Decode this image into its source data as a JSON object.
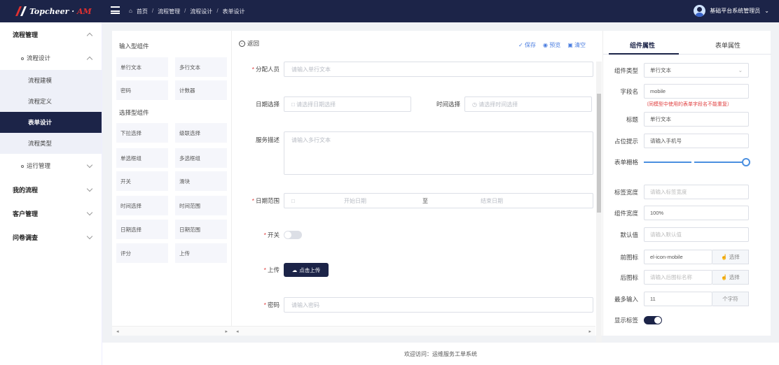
{
  "header": {
    "logo_text": "Topcheer",
    "logo_accent": "AM",
    "breadcrumb": [
      "首页",
      "流程管理",
      "流程设计",
      "表单设计"
    ],
    "user": "基础平台系统管理员",
    "bg": "#1c2448"
  },
  "sidebar": {
    "g1": "流程管理",
    "sub1": "流程设计",
    "leaf1": "流程建模",
    "leaf2": "流程定义",
    "leaf3": "表单设计",
    "leaf4": "流程类型",
    "sub2": "运行管理",
    "g2": "我的流程",
    "g3": "客户管理",
    "g4": "问卷调查"
  },
  "components": {
    "input_title": "输入型组件",
    "select_title": "选择型组件",
    "items": [
      "单行文本",
      "多行文本",
      "密码",
      "计数器",
      "下拉选择",
      "级联选择",
      "单选框组",
      "多选框组",
      "开关",
      "滑块",
      "时间选择",
      "时间范围",
      "日期选择",
      "日期范围",
      "评分",
      "上传"
    ]
  },
  "center": {
    "back": "返回",
    "save": "保存",
    "preview": "预览",
    "clear": "清空",
    "f_assignee": "分配人员",
    "f_assignee_ph": "请输入单行文本",
    "f_date": "日期选择",
    "f_date_ph": "请选择日期选择",
    "f_time": "时间选择",
    "f_time_ph": "请选择时间选择",
    "f_desc": "服务描述",
    "f_desc_ph": "请输入多行文本",
    "f_range": "日期范围",
    "f_range_start": "开始日期",
    "f_range_to": "至",
    "f_range_end": "结束日期",
    "f_switch": "开关",
    "f_upload": "上传",
    "f_upload_btn": "点击上传",
    "f_pwd": "密码",
    "f_pwd_ph": "请输入密码"
  },
  "props": {
    "tab1": "组件属性",
    "tab2": "表单属性",
    "type_label": "组件类型",
    "type_value": "单行文本",
    "field_label": "字段名",
    "field_value": "mobile",
    "field_note": "（同模型中使用的表单字段名不能重复）",
    "title_label": "标题",
    "title_value": "单行文本",
    "ph_label": "占位提示",
    "ph_value": "请输入手机号",
    "grid_label": "表单栅格",
    "grid_value": 1,
    "lw_label": "标签宽度",
    "lw_ph": "请输入标签宽度",
    "cw_label": "组件宽度",
    "cw_value": "100%",
    "def_label": "默认值",
    "def_ph": "请输入默认值",
    "pre_label": "前图标",
    "pre_value": "el-icon-mobile",
    "pick": "选择",
    "suf_label": "后图标",
    "suf_ph": "请输入后图标名称",
    "max_label": "最多输入",
    "max_value": "11",
    "max_unit": "个字符",
    "showlabel_label": "显示标签"
  },
  "footer": "欢迎访问：运维服务工单系统"
}
